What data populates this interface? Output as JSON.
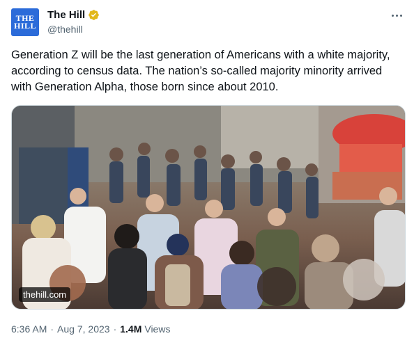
{
  "author": {
    "display_name": "The Hill",
    "handle": "@thehill",
    "logo_lines": [
      "THE",
      "HILL"
    ],
    "verified_color": "#e2b719"
  },
  "tweet": {
    "text": "Generation Z will be the last generation of Americans with a white majority, according to census data. The nation’s so-called majority minority arrived with Generation Alpha, those born since about 2010.",
    "media_watermark": "thehill.com",
    "media_icon": "crowd-photo"
  },
  "meta": {
    "time": "6:36 AM",
    "separator": "·",
    "date": "Aug 7, 2023",
    "views_count": "1.4M",
    "views_label": "Views"
  },
  "colors": {
    "text": "#0f1419",
    "secondary": "#536471",
    "avatar_bg": "#2b6bd9"
  }
}
